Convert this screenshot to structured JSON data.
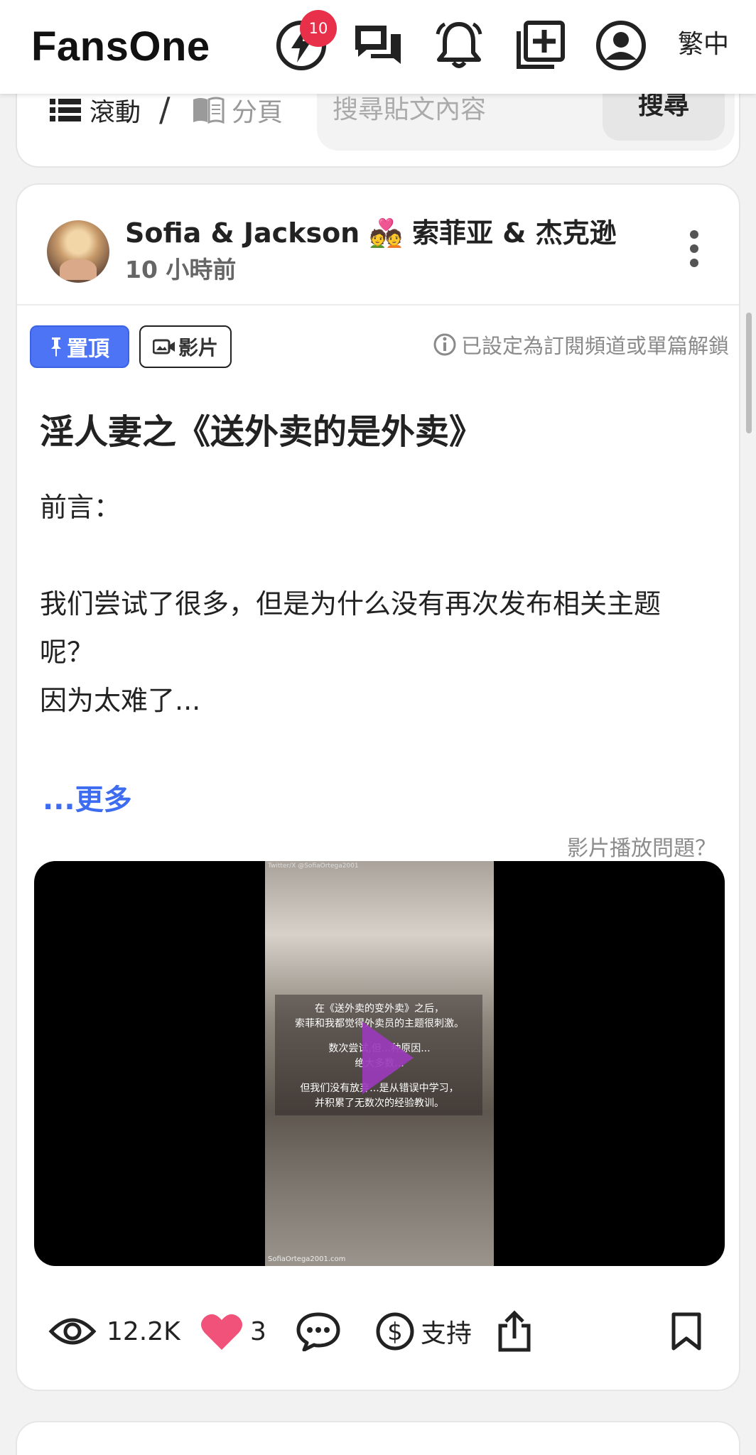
{
  "header": {
    "logo": "FansOne",
    "notification_badge": "10",
    "language_label": "繁中",
    "icons": [
      "lightning-icon",
      "chat-icon",
      "bell-icon",
      "add-post-icon",
      "account-icon"
    ]
  },
  "view_mode": {
    "scroll_label": "滾動",
    "separator": "/",
    "page_label": "分頁"
  },
  "search": {
    "placeholder": "搜尋貼文內容",
    "button_label": "搜尋"
  },
  "post": {
    "author": "Sofia & Jackson 💑 索菲亚 & 杰克逊",
    "time": "10 小時前",
    "tags": {
      "pinned": "置頂",
      "video": "影片"
    },
    "subscription_note": "已設定為訂閱頻道或單篇解鎖",
    "title": "淫人妻之《送外卖的是外卖》",
    "body": {
      "line1": "前言：",
      "line2": "",
      "line3": "我们尝试了很多，但是为什么没有再次发布相关主题",
      "line4": "呢？",
      "line5": "因为太难了..."
    },
    "read_more": "...更多",
    "video_issue": "影片播放問題？",
    "video": {
      "top_caption": "Twitter/X @SofiaOrtega2001",
      "bottom_caption": "SofiaOrtega2001.com",
      "overlay_lines": {
        "l1": "在《送外卖的变外卖》之后，",
        "l2": "索菲和我都觉得外卖员的主题很刺激。",
        "l3": "数次尝试,但...种原因...",
        "l4": "绝大多数...",
        "l5": "但我们没有放弃...是从错误中学习，",
        "l6": "并积累了无数次的经验教训。"
      }
    },
    "actions": {
      "views": "12.2K",
      "likes": "3",
      "support_label": "支持"
    }
  },
  "colors": {
    "accent_blue": "#4d74f5",
    "link_blue": "#3d6cf0",
    "badge_red": "#e8304a",
    "heart_pink": "#f0527a",
    "play_purple": "#9b3bbb"
  }
}
